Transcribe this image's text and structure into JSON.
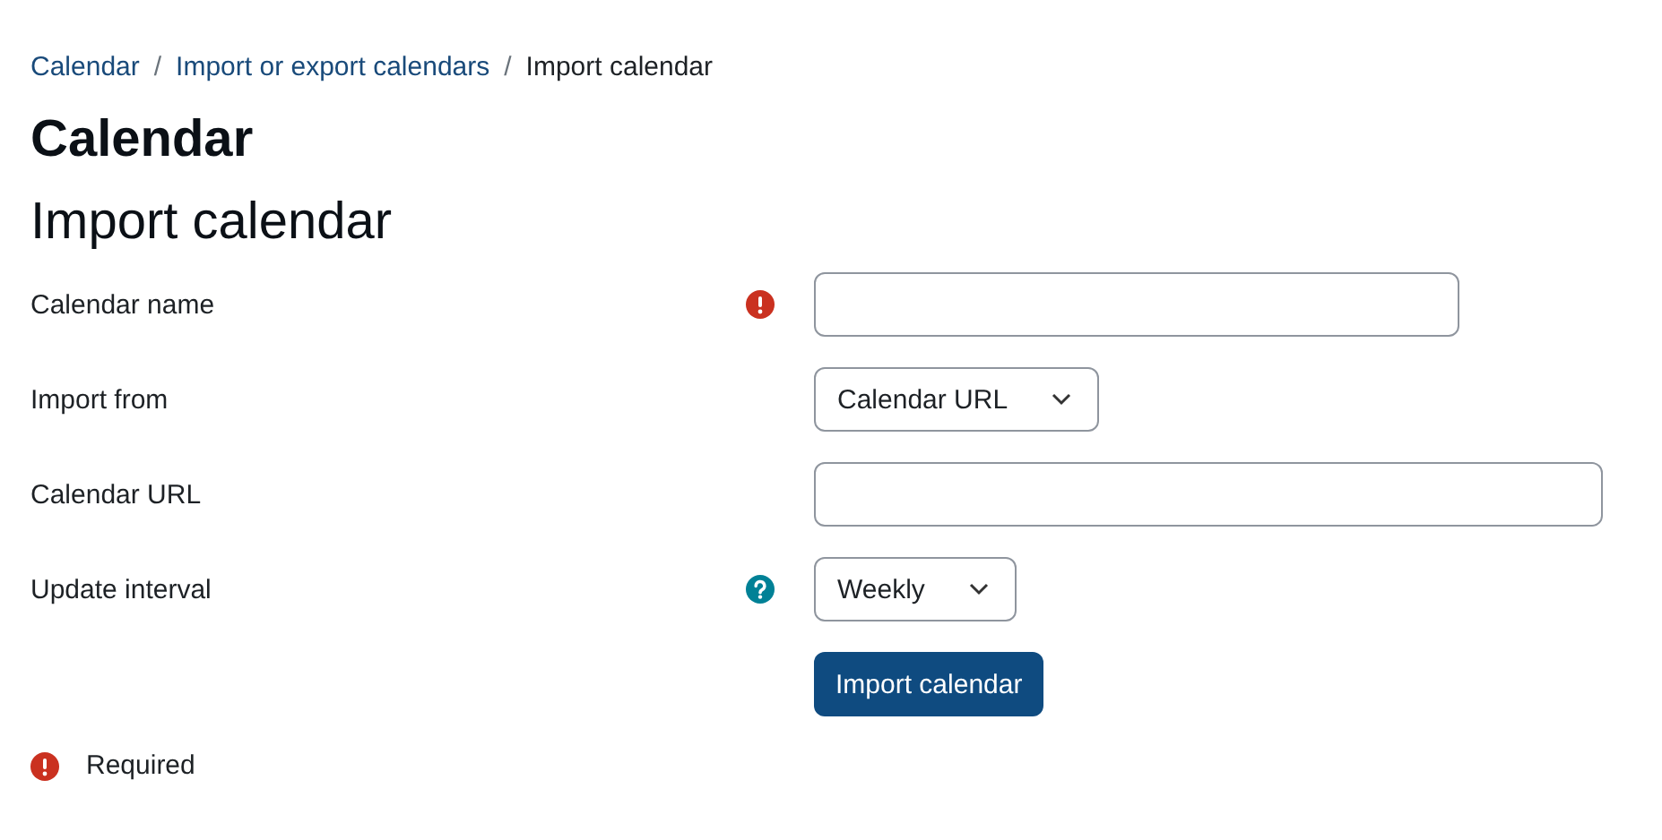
{
  "breadcrumb": [
    {
      "kind": "link",
      "label": "Calendar"
    },
    {
      "kind": "separator",
      "label": "/"
    },
    {
      "kind": "link",
      "label": "Import or export calendars"
    },
    {
      "kind": "separator",
      "label": "/"
    },
    {
      "kind": "current",
      "label": "Import calendar"
    }
  ],
  "page_title": "Calendar",
  "form_title": "Import calendar",
  "fields": [
    {
      "kind": "text",
      "label": "Calendar name",
      "required": true,
      "help": false
    },
    {
      "kind": "select",
      "label": "Import from",
      "required": false,
      "help": false,
      "value": "Calendar URL"
    },
    {
      "kind": "url",
      "label": "Calendar URL",
      "required": false,
      "help": false
    },
    {
      "kind": "select",
      "label": "Update interval",
      "required": false,
      "help": true,
      "value": "Weekly"
    }
  ],
  "submit_button": "Import calendar",
  "required_note": "Required"
}
